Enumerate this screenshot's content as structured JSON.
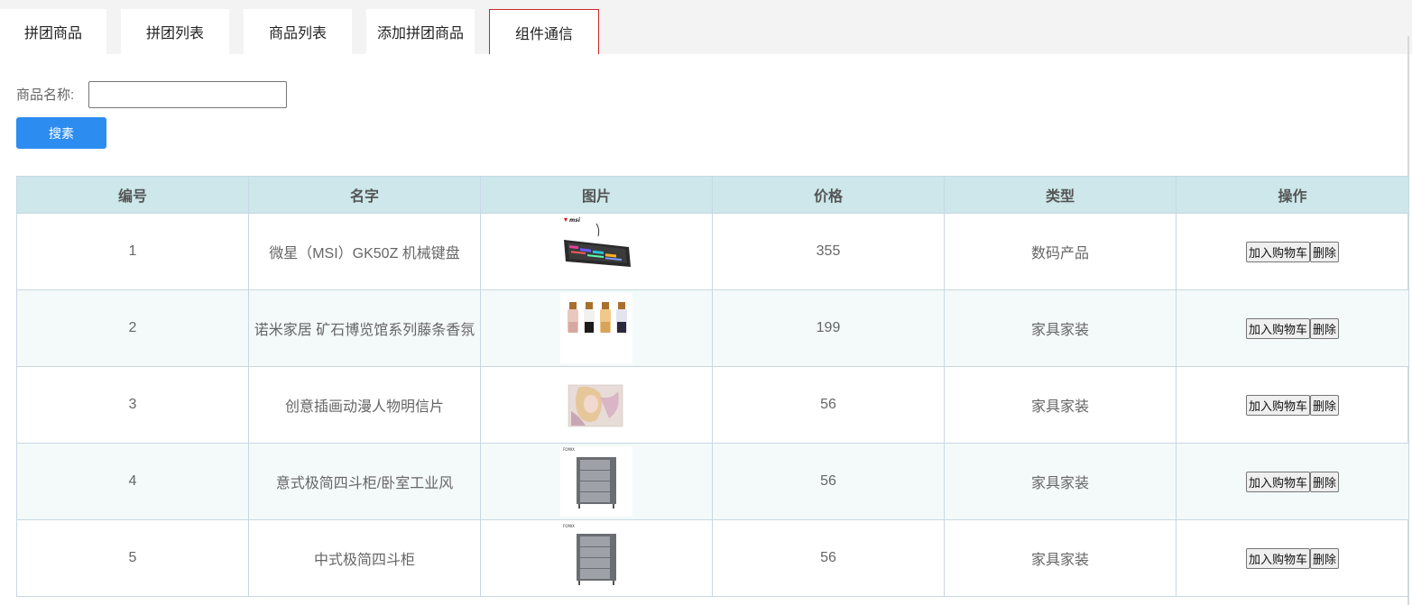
{
  "tabs": [
    {
      "label": "拼团商品",
      "active": false
    },
    {
      "label": "拼团列表",
      "active": false
    },
    {
      "label": "商品列表",
      "active": false
    },
    {
      "label": "添加拼团商品",
      "active": false
    },
    {
      "label": "组件通信",
      "active": true
    }
  ],
  "search": {
    "label": "商品名称:",
    "value": "",
    "placeholder": "",
    "button_label": "搜素"
  },
  "table": {
    "headers": [
      "编号",
      "名字",
      "图片",
      "价格",
      "类型",
      "操作"
    ],
    "rows": [
      {
        "id": "1",
        "name": "微星（MSI）GK50Z 机械键盘",
        "image": "keyboard-image",
        "price": "355",
        "type": "数码产品",
        "add_label": "加入购物车",
        "delete_label": "删除"
      },
      {
        "id": "2",
        "name": "诺米家居 矿石博览馆系列藤条香氛",
        "image": "perfume-bottles-image",
        "price": "199",
        "type": "家具家装",
        "add_label": "加入购物车",
        "delete_label": "删除"
      },
      {
        "id": "3",
        "name": "创意插画动漫人物明信片",
        "image": "anime-postcard-image",
        "price": "56",
        "type": "家具家装",
        "add_label": "加入购物车",
        "delete_label": "删除"
      },
      {
        "id": "4",
        "name": "意式极简四斗柜/卧室工业风",
        "image": "drawer-cabinet-image",
        "price": "56",
        "type": "家具家装",
        "add_label": "加入购物车",
        "delete_label": "删除"
      },
      {
        "id": "5",
        "name": "中式极简四斗柜",
        "image": "drawer-cabinet-image",
        "price": "56",
        "type": "家具家装",
        "add_label": "加入购物车",
        "delete_label": "删除"
      }
    ]
  },
  "brand_marks": {
    "keyboard": "msi",
    "cabinet": "FOMIX"
  },
  "colors": {
    "primary_button": "#2d8cf0",
    "active_tab_border": "#c9282d",
    "table_header_bg": "#cde7ea"
  }
}
